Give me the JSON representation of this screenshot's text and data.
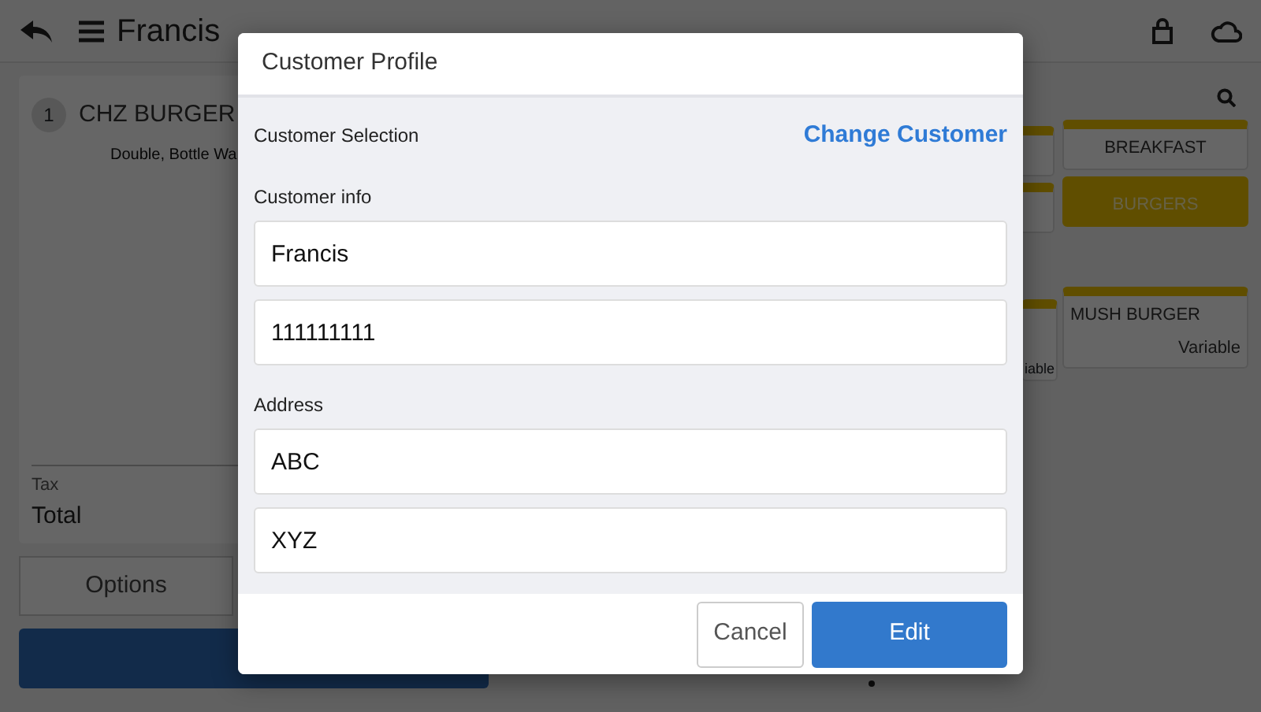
{
  "header": {
    "title": "Francis"
  },
  "order": {
    "items": [
      {
        "qty": "1",
        "name": "CHZ BURGER",
        "modifiers": "Double, Bottle Wa"
      }
    ],
    "tax_label": "Tax",
    "total_label": "Total",
    "options_button": "Options"
  },
  "menu": {
    "categories": [
      {
        "label": "BREAKFAST",
        "selected": false
      },
      {
        "label": "BURGERS",
        "selected": true
      }
    ],
    "items": [
      {
        "label": "MUSH BURGER",
        "price": "Variable"
      }
    ],
    "partial_item_price": "iable"
  },
  "modal": {
    "title": "Customer Profile",
    "selection_label": "Customer Selection",
    "change_link": "Change Customer",
    "info_label": "Customer info",
    "info_fields": [
      {
        "value": "Francis"
      },
      {
        "value": "111111111"
      }
    ],
    "address_label": "Address",
    "address_fields": [
      {
        "value": "ABC"
      },
      {
        "value": "XYZ"
      }
    ],
    "buttons": [
      {
        "label": "Cancel",
        "kind": "secondary"
      },
      {
        "label": "Edit",
        "kind": "primary"
      }
    ]
  }
}
